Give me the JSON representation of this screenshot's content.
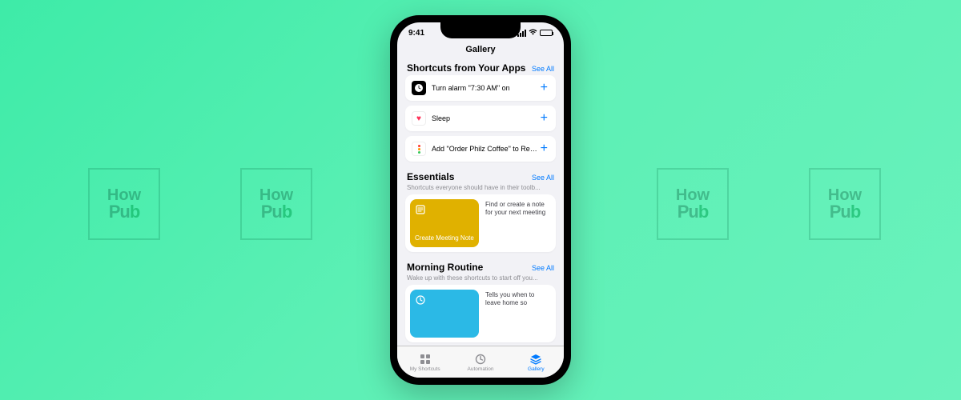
{
  "statusbar": {
    "time": "9:41"
  },
  "nav": {
    "title": "Gallery"
  },
  "sections": {
    "apps": {
      "title": "Shortcuts from Your Apps",
      "seeall": "See All",
      "items": [
        {
          "label": "Turn alarm \"7:30 AM\" on"
        },
        {
          "label": "Sleep"
        },
        {
          "label": "Add \"Order Philz Coffee\" to Remin..."
        }
      ]
    },
    "essentials": {
      "title": "Essentials",
      "seeall": "See All",
      "subtitle": "Shortcuts everyone should have in their toolb...",
      "tile_title": "Create Meeting Note",
      "tile_desc": "Find or create a note for your next meeting"
    },
    "morning": {
      "title": "Morning Routine",
      "seeall": "See All",
      "subtitle": "Wake up with these shortcuts to start off you...",
      "tile_desc": "Tells you when to leave home so"
    }
  },
  "tabs": {
    "my": "My Shortcuts",
    "automation": "Automation",
    "gallery": "Gallery"
  },
  "watermark": {
    "top": "How",
    "bot_p": "P",
    "bot_u": "u",
    "bot_b": "b"
  }
}
